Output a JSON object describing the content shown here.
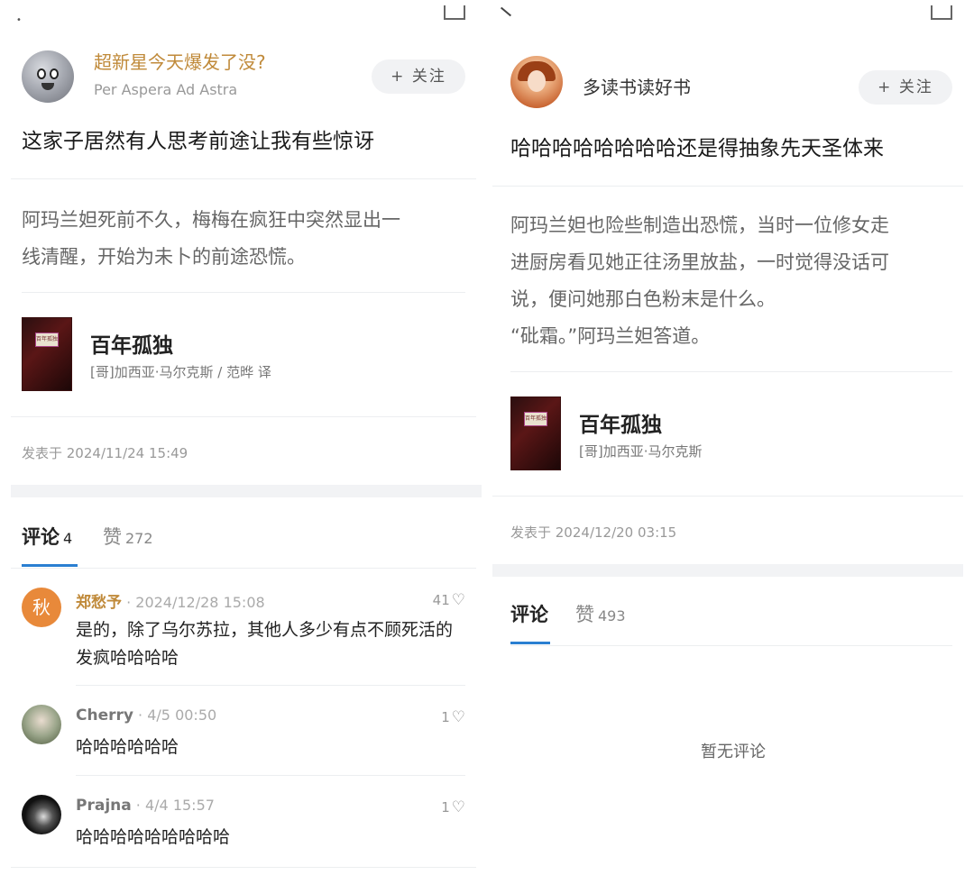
{
  "left": {
    "user": {
      "name": "超新星今天爆发了没?",
      "subtitle": "Per Aspera Ad Astra",
      "follow_label": "+ 关注"
    },
    "post_title": "这家子居然有人思考前途让我有些惊讶",
    "quote_lines": [
      "阿玛兰妲死前不久，梅梅在疯狂中突然显出一",
      "线清醒，开始为未卜的前途恐慌。"
    ],
    "book": {
      "title": "百年孤独",
      "author": "[哥]加西亚·马尔克斯 / 范晔 译",
      "cover_text": "百年孤独"
    },
    "date": "发表于 2024/11/24 15:49",
    "tabs": {
      "comments_label": "评论",
      "comments_count": "4",
      "likes_label": "赞",
      "likes_count": "272"
    },
    "comments": [
      {
        "name": "郑愁予",
        "time": " · 2024/12/28 15:08",
        "likes": "41",
        "text": "是的，除了乌尔苏拉，其他人多少有点不顾死活的发疯哈哈哈哈",
        "avatar_text": "秋"
      },
      {
        "name": "Cherry",
        "time": " · 4/5 00:50",
        "likes": "1",
        "text": "哈哈哈哈哈哈"
      },
      {
        "name": "Prajna",
        "time": " · 4/4 15:57",
        "likes": "1",
        "text": "哈哈哈哈哈哈哈哈哈"
      }
    ]
  },
  "right": {
    "user": {
      "name": "多读书读好书",
      "follow_label": "+ 关注"
    },
    "post_title": "哈哈哈哈哈哈哈哈还是得抽象先天圣体来",
    "quote_lines": [
      "阿玛兰妲也险些制造出恐慌，当时一位修女走",
      "进厨房看见她正往汤里放盐，一时觉得没话可",
      "说，便问她那白色粉末是什么。",
      "“砒霜。”阿玛兰妲答道。"
    ],
    "book": {
      "title": "百年孤独",
      "author": "[哥]加西亚·马尔克斯",
      "cover_text": "百年孤独"
    },
    "date": "发表于 2024/12/20 03:15",
    "tabs": {
      "comments_label": "评论",
      "likes_label": "赞",
      "likes_count": "493"
    },
    "empty_text": "暂无评论"
  },
  "colors": {
    "accent": "#2a7fd1",
    "username_gold": "#c08a3a"
  }
}
